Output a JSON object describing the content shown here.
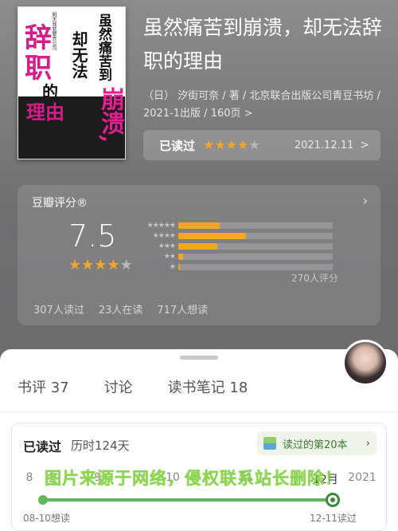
{
  "book": {
    "title": "虽然痛苦到崩溃，却无法辞职的理由",
    "meta": "（日） 汐街可奈 / 著 / 北京联合出版公司青豆书坊 / 2021-1出版 / 160页 >",
    "cover": {
      "big1": "辞",
      "big2": "职",
      "big3": "的",
      "big4": "理由",
      "vertical1": "虽然痛苦到",
      "vertical2": "崩溃,",
      "vertical3": "却无法",
      "small": "明天我就要去公司"
    }
  },
  "read_status": {
    "label": "已读过",
    "stars_on": 4,
    "stars_total": 5,
    "date": "2021.12.11",
    "chevron": ">"
  },
  "rating": {
    "title": "豆瓣评分®",
    "score": "7.5",
    "stars_on": 4,
    "distribution": [
      {
        "stars": "★★★★★",
        "pct": 0.27
      },
      {
        "stars": "★★★★",
        "pct": 0.44
      },
      {
        "stars": "★★★",
        "pct": 0.25
      },
      {
        "stars": "★★",
        "pct": 0.03
      },
      {
        "stars": "★",
        "pct": 0.01
      }
    ],
    "count": "270人评分",
    "stats": [
      "307人读过",
      "23人在读",
      "717人想读"
    ]
  },
  "tabs": [
    "书评 37",
    "讨论",
    "读书笔记 18"
  ],
  "timeline": {
    "status": "已读过",
    "duration": "历时124天",
    "badge": "读过的第20本",
    "axis": [
      "8",
      "9",
      "10",
      "11",
      "12月",
      "2021"
    ],
    "start_label": "08-10想读",
    "end_label": "12-11读过"
  },
  "watermark": "图片来源于网络，侵权联系站长删除！",
  "colors": {
    "accent_star": "#f5a623",
    "timeline_green": "#5fb85a",
    "cover_magenta": "#d81b8a"
  }
}
